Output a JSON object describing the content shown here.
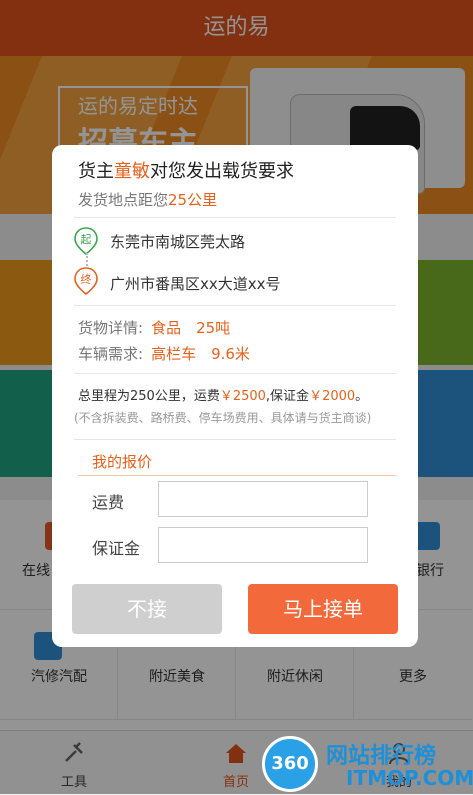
{
  "header": {
    "title": "运的易"
  },
  "banner": {
    "line1": "运的易定时达",
    "line2": "招募车主"
  },
  "grid": {
    "row1": [
      "在线",
      "",
      "",
      "银行"
    ],
    "row2": [
      "汽修汽配",
      "附近美食",
      "附近休闲",
      "更多"
    ]
  },
  "tabbar": {
    "tools": "工具",
    "home": "首页",
    "mine": "我的"
  },
  "watermark": {
    "logo": "360",
    "name": "网站排行榜",
    "site": "ITMOP.COM"
  },
  "dialog": {
    "title_pre": "货主",
    "title_name": "童敏",
    "title_post": "对您发出载货要求",
    "distance_pre": "发货地点距您",
    "distance_val": "25公里",
    "from_tag": "起",
    "from": "东莞市南城区莞太路",
    "to_tag": "终",
    "to": "广州市番禺区xx大道xx号",
    "goods_label": "货物详情:",
    "goods_value": "食品　25吨",
    "vehicle_label": "车辆需求:",
    "vehicle_value": "高栏车　9.6米",
    "total_pre": "总里程为250公里，运费",
    "freight": "￥2500",
    "total_mid": ",保证金",
    "deposit": "￥2000",
    "total_end": "。",
    "note": "(不含拆装费、路桥费、停车场费用、具体请与货主商谈)",
    "bid_title": "我的报价",
    "freight_label": "运费",
    "deposit_label": "保证金",
    "freight_input": "",
    "deposit_input": "",
    "reject_label": "不接",
    "accept_label": "马上接单"
  },
  "colors": {
    "accent": "#e8611c",
    "header": "#e2531c",
    "accept": "#f2693c",
    "reject": "#cfcfcf"
  },
  "icons": [
    "home-icon",
    "tools-icon",
    "user-icon",
    "start-pin-icon",
    "end-pin-icon",
    "car-icon",
    "bag-icon",
    "bank-icon"
  ]
}
